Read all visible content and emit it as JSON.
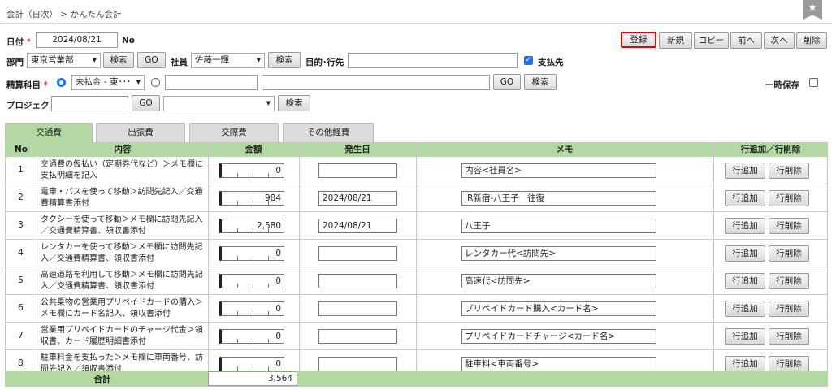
{
  "breadcrumb": {
    "link": "会計（日次）",
    "separator": ">",
    "current": "かんたん会計"
  },
  "toolbar": {
    "register": "登録",
    "new": "新規",
    "copy": "コピー",
    "prev": "前へ",
    "next": "次へ",
    "delete": "削除"
  },
  "form": {
    "date_label": "日付",
    "required_mark": "*",
    "date_value": "2024/08/21",
    "no_label": "No",
    "dept_label": "部門",
    "dept_value": "東京営業部",
    "search": "検索",
    "go": "GO",
    "employee_label": "社員",
    "employee_value": "佐藤一輝",
    "purpose_label": "目的･行先",
    "purpose_value": "",
    "payment_label": "支払先",
    "payment_checked": true,
    "account_label": "精算科目",
    "account_value": "未払金 - 東･･･",
    "account_code_value": "",
    "account_name_value": "",
    "temp_save_label": "一時保存",
    "temp_save_checked": false,
    "project_label": "プロジェクト",
    "project_value": "",
    "project_select_value": ""
  },
  "tabs": [
    "交通費",
    "出張費",
    "交際費",
    "その他経費"
  ],
  "active_tab": 0,
  "table": {
    "headers": [
      "No",
      "内容",
      "金額",
      "発生日",
      "メモ",
      "行追加／行削除"
    ],
    "add_label": "行追加",
    "remove_label": "行削除",
    "rows": [
      {
        "no": "1",
        "desc": "交通費の仮払い（定期券代など）＞メモ欄に支払明細を記入",
        "amount": "0",
        "date": "",
        "memo": "内容<社員名>"
      },
      {
        "no": "2",
        "desc": "電車・バスを使って移動＞訪問先記入／交通費精算書添付",
        "amount": "984",
        "date": "2024/08/21",
        "memo": "JR新宿-八王子　往復"
      },
      {
        "no": "3",
        "desc": "タクシーを使って移動＞メモ欄に訪問先記入／交通費精算書、領収書添付",
        "amount": "2,580",
        "date": "2024/08/21",
        "memo": "八王子"
      },
      {
        "no": "4",
        "desc": "レンタカーを使って移動＞メモ欄に訪問先記入／交通費精算書、領収書添付",
        "amount": "0",
        "date": "",
        "memo": "レンタカー代<訪問先>"
      },
      {
        "no": "5",
        "desc": "高速道路を利用して移動＞メモ欄に訪問先記入／交通費精算書、領収書添付",
        "amount": "0",
        "date": "",
        "memo": "高速代<訪問先>"
      },
      {
        "no": "6",
        "desc": "公共乗物の営業用プリペイドカードの購入＞メモ欄にカード名記入、領収書添付",
        "amount": "0",
        "date": "",
        "memo": "プリペイドカード購入<カード名>"
      },
      {
        "no": "7",
        "desc": "営業用プリペイドカードのチャージ代金＞領収書、カード履歴明細書添付",
        "amount": "0",
        "date": "",
        "memo": "プリペイドカードチャージ<カード名>"
      },
      {
        "no": "8",
        "desc": "駐車料金を支払った＞メモ欄に車両番号、訪問先記入／領収書添付",
        "amount": "0",
        "date": "",
        "memo": "駐車料<車両番号>"
      }
    ],
    "total_label": "合計",
    "total_value": "3,564"
  },
  "colors": {
    "header_green": "#b3d8a3",
    "required_red": "#e00000",
    "checkbox_blue": "#1a73e8"
  },
  "icons": {
    "bookmark": "star-icon"
  }
}
